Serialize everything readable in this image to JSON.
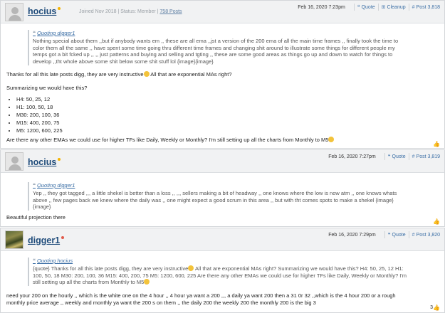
{
  "posts": [
    {
      "username": "hocius",
      "user_info_joined": "Joined Nov 2018",
      "user_info_status": "Status: Member",
      "user_info_posts": "758 Posts",
      "date": "Feb 16, 2020 7:23pm",
      "quote_label": "Quote",
      "cleanup_label": "Cleanup",
      "post_number": "Post 3,818",
      "quoting": "Quoting digger1",
      "quote_lines": [
        "Nothing special about them ,,but if anybody wants em ,, these are all ema ,,jst a version of the 200 ema of all the main time frames ,, finally took the time to",
        "color them all the same ,, have spent some time going thru different time frames and changing shit around to illustrate some things for different people my",
        "temps got a bit fcked up ,, ,, just patterns and buying and selling and tgting ,, these are some good areas as things go up and down to watch for things to",
        "develop ,,tht whole above some shit below some shit stuff lol {image}{image}"
      ],
      "text_1": "Thanks for all this late posts digg, they are very instructive",
      "text_1b": " All that are exponential MAs right?",
      "text_2": "Summarizing we would have this?",
      "list": [
        "H4: 50, 25, 12",
        "H1: 100, 50, 18",
        "M30: 200, 100, 36",
        "M15: 400, 200, 75",
        "M5: 1200, 600, 225"
      ],
      "text_3": "Are there any other EMAs we could use for higher TFs like Daily, Weekly or Monthly? I'm still setting up all the charts from Monthly to M5"
    },
    {
      "username": "hocius",
      "date": "Feb 16, 2020 7:27pm",
      "quote_label": "Quote",
      "post_number": "Post 3,819",
      "quoting": "Quoting digger1",
      "quote_lines": [
        "Yep ,, they got tagged ,,, a little shekel is better than a loss ,, ,,, sellers making a bit of headway ,, one knows where the low is now atm ,, one knows whats",
        "above ,, few pages back we knew where the daily was ,, one might expect a good scrum in this area ,, but with tht comes spots to make a shekel {image}",
        "{image}"
      ],
      "text_1": "Beautiful projection there"
    },
    {
      "username": "digger1",
      "date": "Feb 16, 2020 7:29pm",
      "quote_label": "Quote",
      "post_number": "Post 3,820",
      "quoting": "Quoting hocius",
      "quote_lines": [
        "{quote} Thanks for all this late posts digg, they are very instructive",
        " All that are exponential MAs right? Summarizing we would have this? H4: 50, 25, 12 H1:",
        "100, 50, 18 M30: 200, 100, 36 M15: 400, 200, 75 M5: 1200, 600, 225 Are there any other EMAs we could use for higher TFs like Daily, Weekly or Monthly? I'm",
        "still setting up all the charts from Monthly to M5"
      ],
      "text_lines": [
        "need your 200 on the hourly ,, which is the white one on the 4 hour ,, 4 hour ya want a 200 ,,, a daily ya want 200 then a 31 0r 32 ,,which is the 4 hour 200 or a rough",
        "monthly price average ,, weekly and monthly ya want the 200 s on them ,, the daily 200 the weekly 200 the monthly 200 is the big 3"
      ],
      "like_count": "3"
    }
  ],
  "colors": {
    "online": "#f5b400",
    "offline": "#e05a4a",
    "link": "#3a6ea5"
  },
  "icons": {
    "quote": "quote-icon",
    "cleanup": "cleanup-icon",
    "post": "post-number-icon",
    "like": "thumbs-up-icon"
  }
}
